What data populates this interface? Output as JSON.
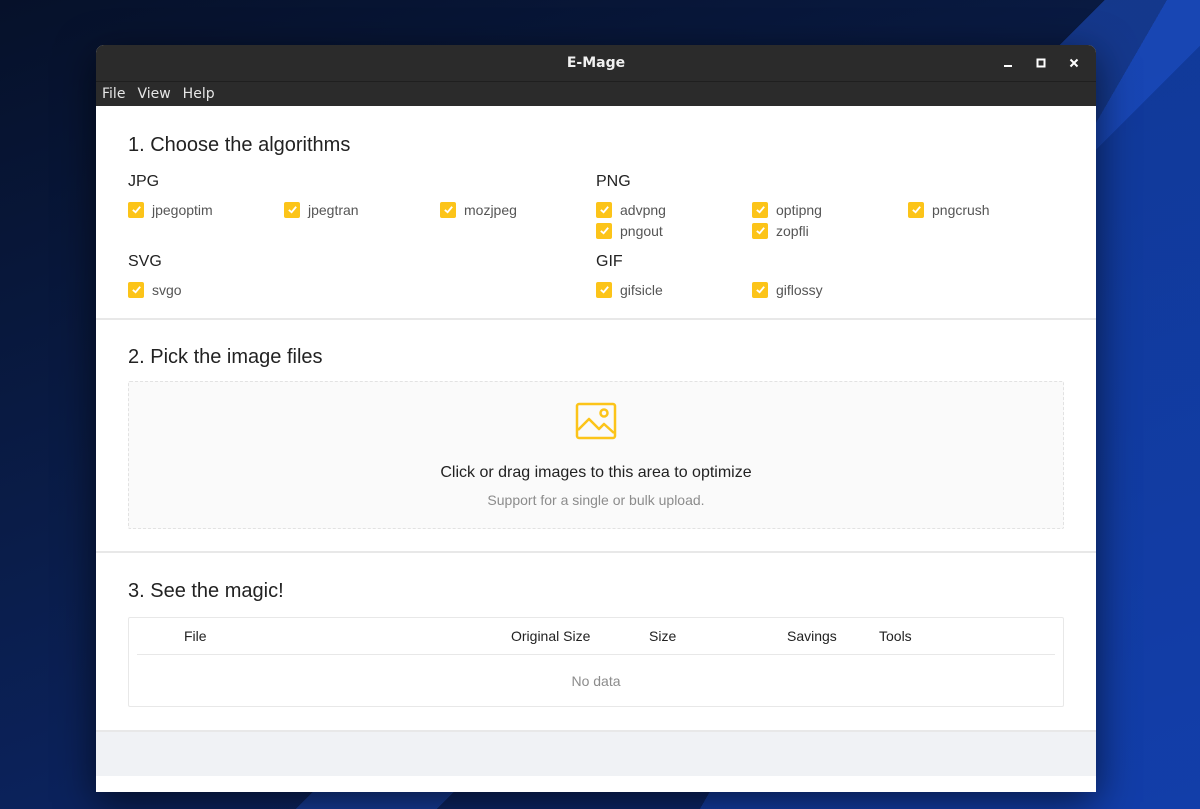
{
  "window": {
    "title": "E-Mage",
    "controls": [
      "minimize",
      "maximize",
      "close"
    ]
  },
  "menu": [
    "File",
    "View",
    "Help"
  ],
  "sections": {
    "algorithms": {
      "title": "1. Choose the algorithms",
      "groups": {
        "jpg": {
          "label": "JPG",
          "options": [
            "jpegoptim",
            "jpegtran",
            "mozjpeg"
          ]
        },
        "png": {
          "label": "PNG",
          "options": [
            "advpng",
            "optipng",
            "pngcrush",
            "pngout",
            "zopfli"
          ]
        },
        "svg": {
          "label": "SVG",
          "options": [
            "svgo"
          ]
        },
        "gif": {
          "label": "GIF",
          "options": [
            "gifsicle",
            "giflossy"
          ]
        }
      }
    },
    "files": {
      "title": "2. Pick the image files",
      "drop_text": "Click or drag images to this area to optimize",
      "drop_hint": "Support for a single or bulk upload."
    },
    "results": {
      "title": "3. See the magic!",
      "columns": [
        "File",
        "Original Size",
        "Size",
        "Savings",
        "Tools"
      ],
      "empty": "No data"
    }
  },
  "colors": {
    "accent": "#fcc419",
    "titlebar": "#2b2b2b",
    "footer": "#f0f2f5"
  },
  "icons": {
    "checkbox": "check-icon",
    "drop": "image-icon"
  }
}
